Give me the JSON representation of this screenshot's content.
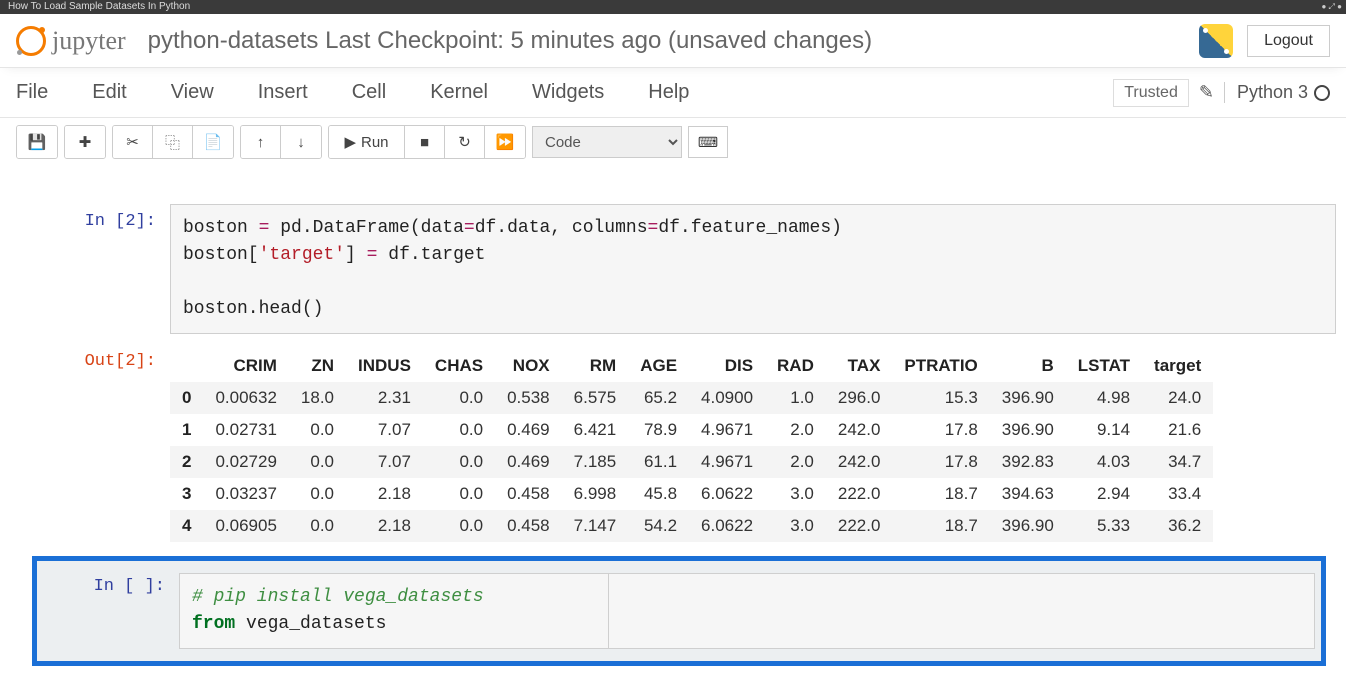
{
  "browser": {
    "tab_title": "How To Load Sample Datasets In Python"
  },
  "header": {
    "brand": "jupyter",
    "title": "python-datasets Last Checkpoint: 5 minutes ago  (unsaved changes)",
    "logout": "Logout"
  },
  "menu": {
    "items": [
      "File",
      "Edit",
      "View",
      "Insert",
      "Cell",
      "Kernel",
      "Widgets",
      "Help"
    ],
    "trusted": "Trusted",
    "kernel": "Python 3"
  },
  "toolbar": {
    "run_label": "Run",
    "cell_type": "Code"
  },
  "cells": [
    {
      "in_prompt": "In [2]:",
      "code": {
        "l1a": "boston ",
        "l1b": "=",
        "l1c": " pd.DataFrame(data",
        "l1d": "=",
        "l1e": "df.data, columns",
        "l1f": "=",
        "l1g": "df.feature_names)",
        "l2a": "boston[",
        "l2b": "'target'",
        "l2c": "] ",
        "l2d": "=",
        "l2e": " df.target",
        "l3": "",
        "l4": "boston.head()"
      },
      "out_prompt": "Out[2]:",
      "table": {
        "columns": [
          "",
          "CRIM",
          "ZN",
          "INDUS",
          "CHAS",
          "NOX",
          "RM",
          "AGE",
          "DIS",
          "RAD",
          "TAX",
          "PTRATIO",
          "B",
          "LSTAT",
          "target"
        ],
        "rows": [
          [
            "0",
            "0.00632",
            "18.0",
            "2.31",
            "0.0",
            "0.538",
            "6.575",
            "65.2",
            "4.0900",
            "1.0",
            "296.0",
            "15.3",
            "396.90",
            "4.98",
            "24.0"
          ],
          [
            "1",
            "0.02731",
            "0.0",
            "7.07",
            "0.0",
            "0.469",
            "6.421",
            "78.9",
            "4.9671",
            "2.0",
            "242.0",
            "17.8",
            "396.90",
            "9.14",
            "21.6"
          ],
          [
            "2",
            "0.02729",
            "0.0",
            "7.07",
            "0.0",
            "0.469",
            "7.185",
            "61.1",
            "4.9671",
            "2.0",
            "242.0",
            "17.8",
            "392.83",
            "4.03",
            "34.7"
          ],
          [
            "3",
            "0.03237",
            "0.0",
            "2.18",
            "0.0",
            "0.458",
            "6.998",
            "45.8",
            "6.0622",
            "3.0",
            "222.0",
            "18.7",
            "394.63",
            "2.94",
            "33.4"
          ],
          [
            "4",
            "0.06905",
            "0.0",
            "2.18",
            "0.0",
            "0.458",
            "7.147",
            "54.2",
            "6.0622",
            "3.0",
            "222.0",
            "18.7",
            "396.90",
            "5.33",
            "36.2"
          ]
        ]
      }
    },
    {
      "in_prompt": "In [ ]:",
      "code": {
        "l1": "# pip install vega_datasets",
        "l2a": "from",
        "l2b": " vega_datasets"
      }
    }
  ]
}
